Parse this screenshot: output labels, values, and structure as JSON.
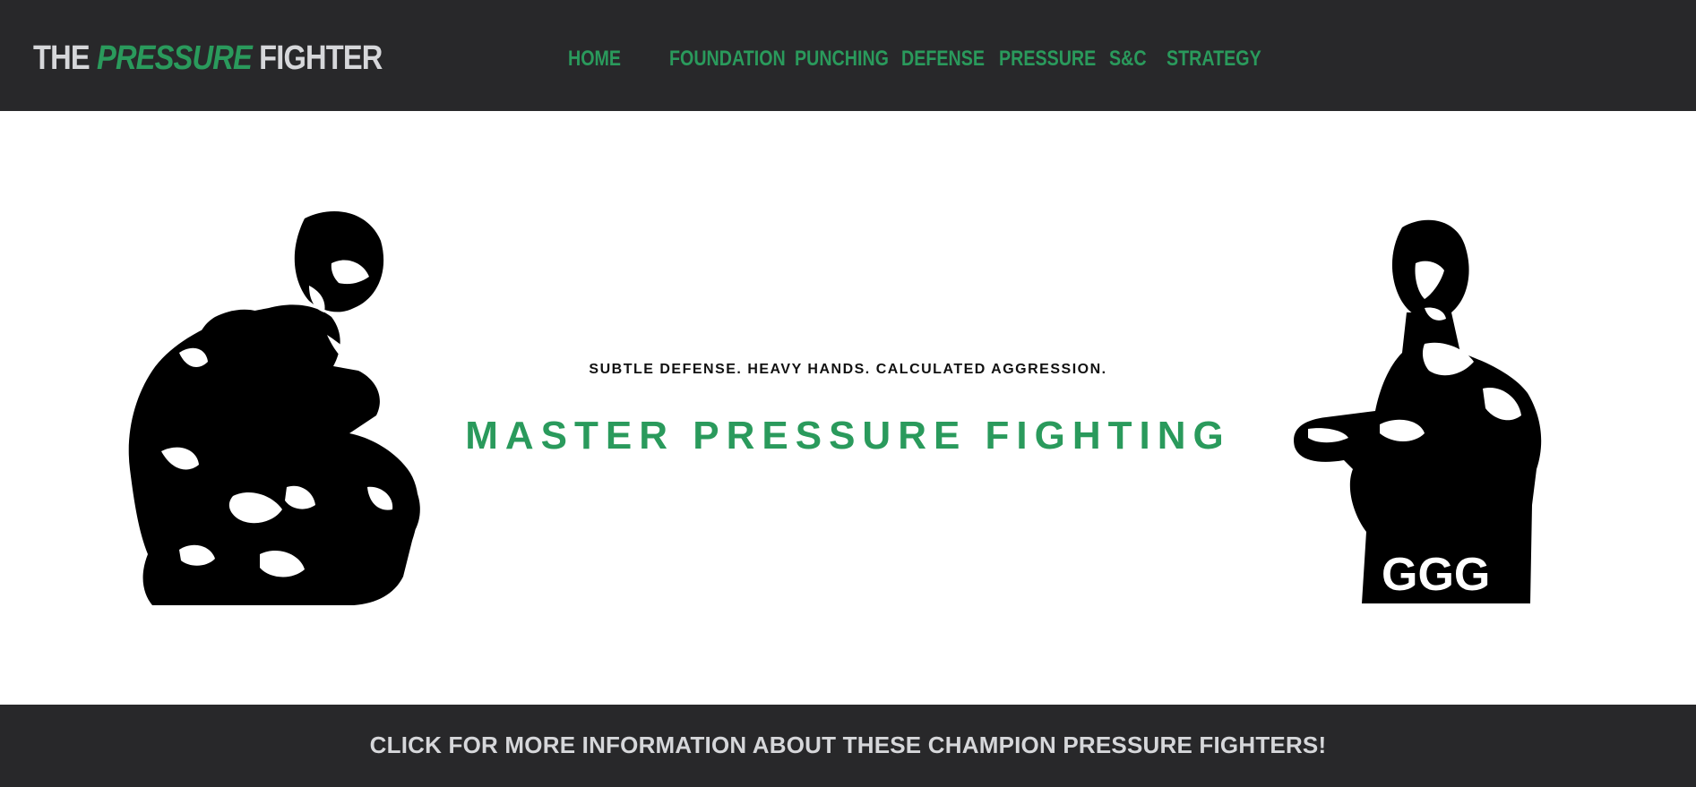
{
  "header": {
    "logo": {
      "part1": "THE ",
      "part2": "PRESSURE",
      "part3": " FIGHTER"
    },
    "nav": [
      {
        "label": "HOME"
      },
      {
        "label": "FOUNDATION"
      },
      {
        "label": "PUNCHING"
      },
      {
        "label": "DEFENSE"
      },
      {
        "label": "PRESSURE"
      },
      {
        "label": "S&C"
      },
      {
        "label": "STRATEGY"
      }
    ]
  },
  "hero": {
    "tagline": "SUBTLE DEFENSE. HEAVY HANDS. CALCULATED AGGRESSION.",
    "headline": "MASTER PRESSURE FIGHTING",
    "right_fighter_trunks": "GGG"
  },
  "footer": {
    "cta": "CLICK FOR MORE INFORMATION ABOUT THESE CHAMPION PRESSURE FIGHTERS!"
  },
  "colors": {
    "bar_bg": "#28282a",
    "accent": "#2a9a5c",
    "light_text": "#d6d7da",
    "dark_text": "#111111"
  }
}
